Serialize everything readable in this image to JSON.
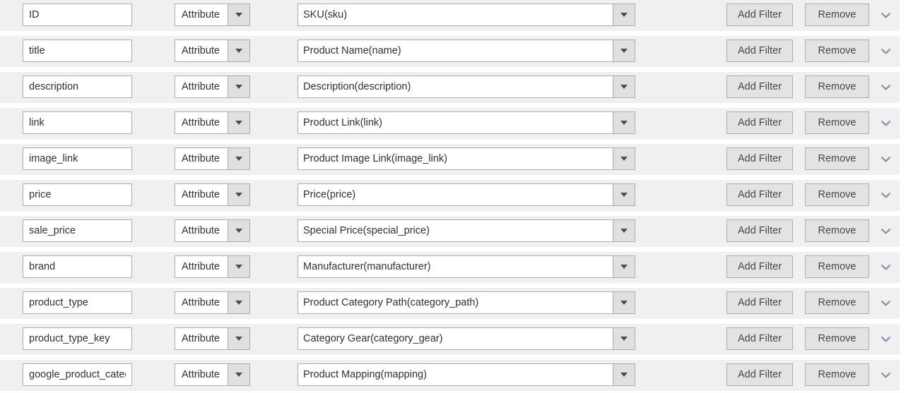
{
  "colors": {
    "row_background": "#f0f0f0",
    "page_background": "#ffffff",
    "field_border": "#adadad",
    "button_background": "#e3e3e3",
    "text": "#303030",
    "chevron": "#8799ab"
  },
  "labels": {
    "add_filter": "Add Filter",
    "remove": "Remove",
    "expand_icon": "chevron-down-icon",
    "select_arrow_icon": "caret-down-icon"
  },
  "rows": [
    {
      "attribute_name": "ID",
      "type": "Attribute",
      "source": "SKU(sku)",
      "add_filter": "Add Filter",
      "remove": "Remove"
    },
    {
      "attribute_name": "title",
      "type": "Attribute",
      "source": "Product Name(name)",
      "add_filter": "Add Filter",
      "remove": "Remove"
    },
    {
      "attribute_name": "description",
      "type": "Attribute",
      "source": "Description(description)",
      "add_filter": "Add Filter",
      "remove": "Remove"
    },
    {
      "attribute_name": "link",
      "type": "Attribute",
      "source": "Product Link(link)",
      "add_filter": "Add Filter",
      "remove": "Remove"
    },
    {
      "attribute_name": "image_link",
      "type": "Attribute",
      "source": "Product Image Link(image_link)",
      "add_filter": "Add Filter",
      "remove": "Remove"
    },
    {
      "attribute_name": "price",
      "type": "Attribute",
      "source": "Price(price)",
      "add_filter": "Add Filter",
      "remove": "Remove"
    },
    {
      "attribute_name": "sale_price",
      "type": "Attribute",
      "source": "Special Price(special_price)",
      "add_filter": "Add Filter",
      "remove": "Remove"
    },
    {
      "attribute_name": "brand",
      "type": "Attribute",
      "source": "Manufacturer(manufacturer)",
      "add_filter": "Add Filter",
      "remove": "Remove"
    },
    {
      "attribute_name": "product_type",
      "type": "Attribute",
      "source": "Product Category Path(category_path)",
      "add_filter": "Add Filter",
      "remove": "Remove"
    },
    {
      "attribute_name": "product_type_key",
      "type": "Attribute",
      "source": "Category Gear(category_gear)",
      "add_filter": "Add Filter",
      "remove": "Remove"
    },
    {
      "attribute_name": "google_product_category",
      "type": "Attribute",
      "source": "Product Mapping(mapping)",
      "add_filter": "Add Filter",
      "remove": "Remove"
    }
  ]
}
